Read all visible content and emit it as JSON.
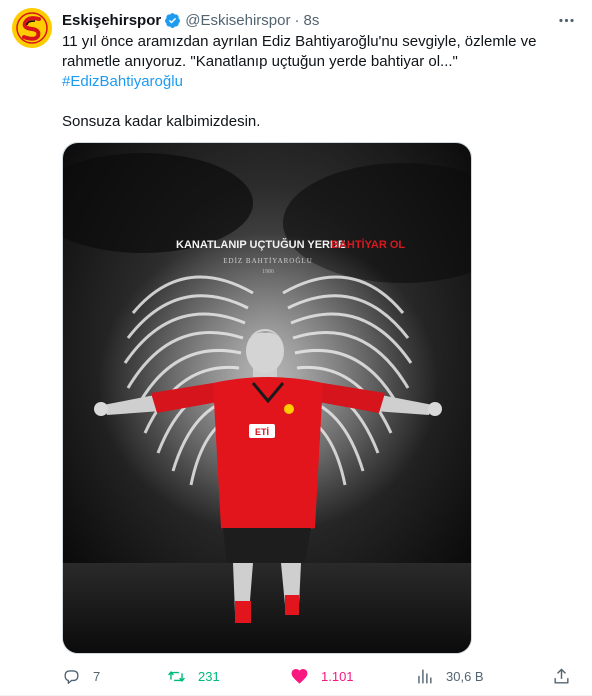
{
  "author": {
    "name": "Eskişehirspor",
    "handle": "@Eskisehirspor",
    "separator": "·",
    "time": "8s"
  },
  "tweet": {
    "line1": "11 yıl önce aramızdan ayrılan Ediz Bahtiyaroğlu'nu sevgiyle, özlemle ve",
    "line2": "rahmetle anıyoruz. \"Kanatlanıp uçtuğun yerde bahtiyar ol...\"",
    "hashtag": "#EdizBahtiyaroğlu",
    "line4": "Sonsuza kadar kalbimizdesin."
  },
  "media": {
    "headline_white": "KANATLANIP UÇTUĞUN YERDE",
    "headline_red": "BAHTİYAR OL",
    "name": "EDİZ BAHTİYAROĞLU",
    "year": "1986",
    "sponsor": "ETİ"
  },
  "actions": {
    "replies": "7",
    "retweets": "231",
    "likes": "1.101",
    "views": "30,6 B"
  },
  "colors": {
    "retweet": "#00ba7c",
    "like": "#f91880",
    "link": "#1d9bf0",
    "secondary": "#536471"
  }
}
